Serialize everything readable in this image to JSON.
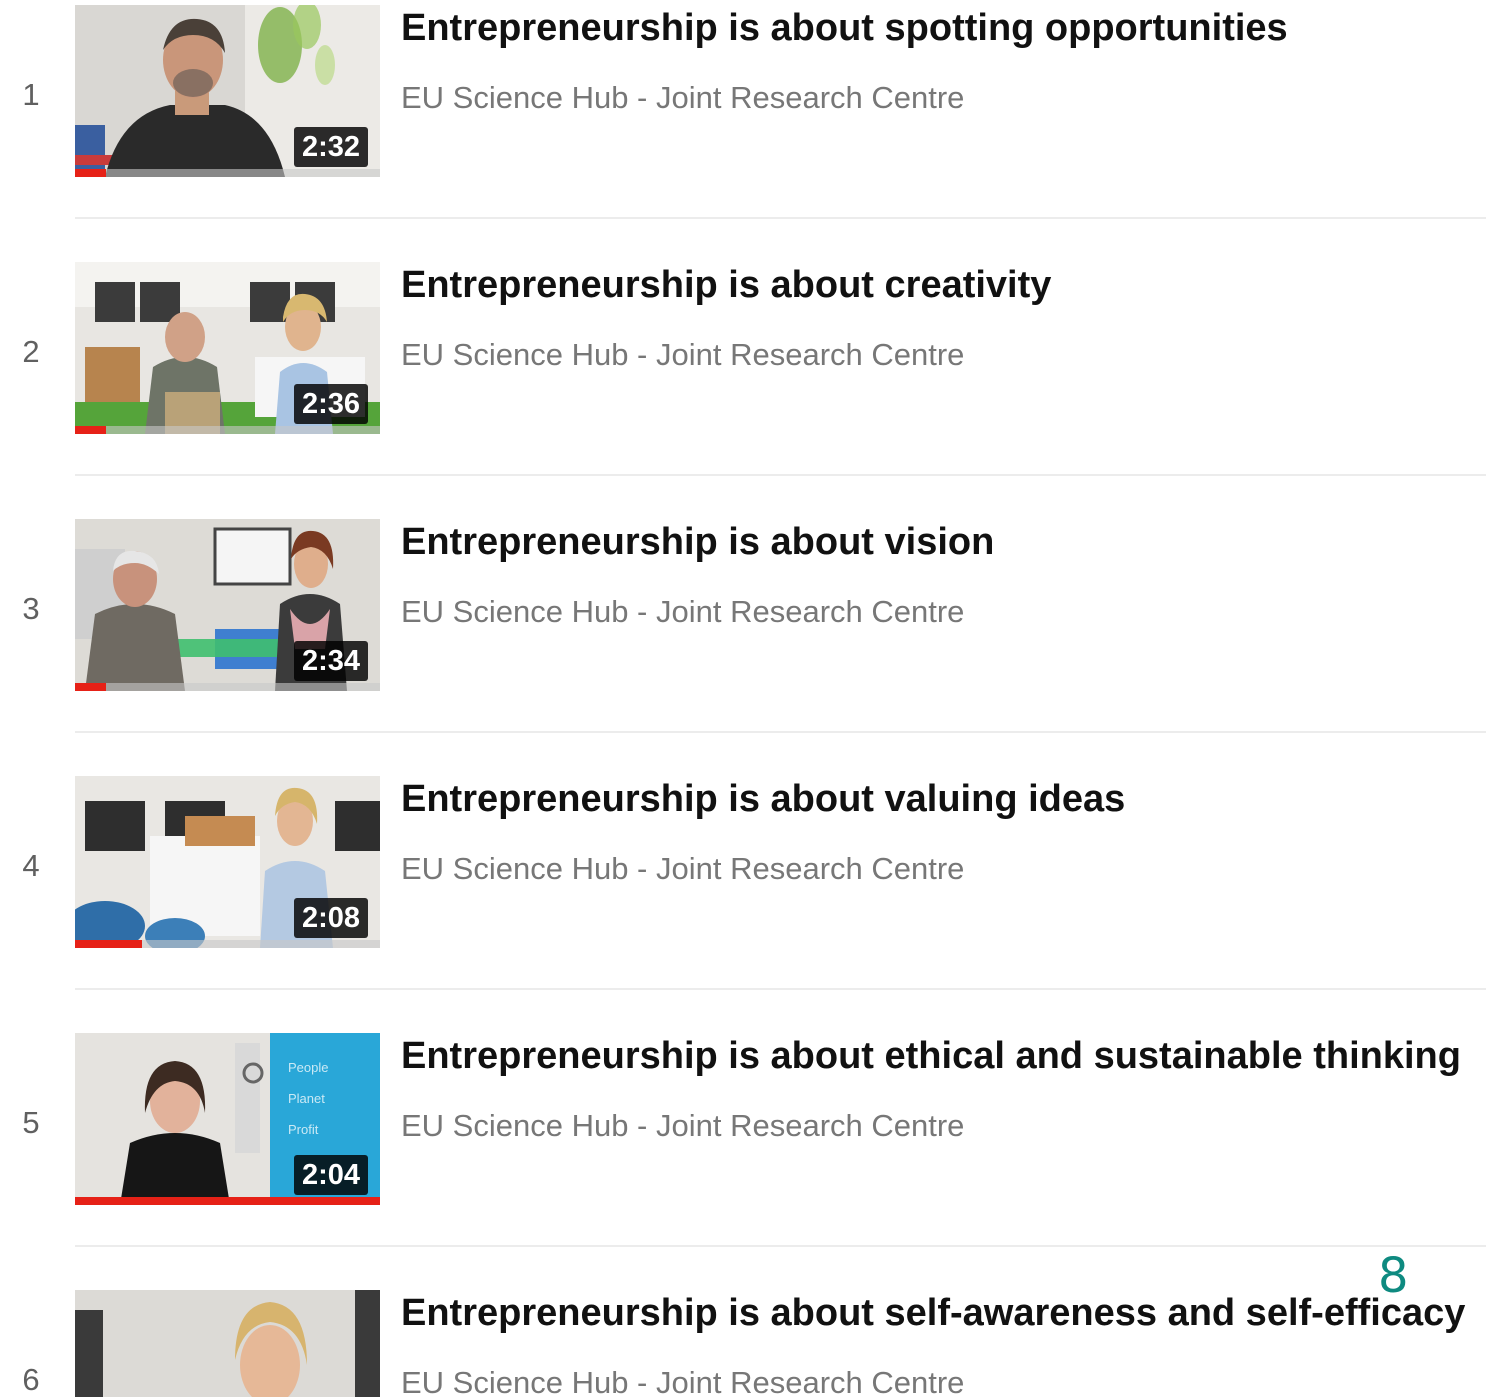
{
  "playlist": {
    "items": [
      {
        "index": "1",
        "title": "Entrepreneurship is about spotting opportunities",
        "channel": "EU Science Hub - Joint Research Centre",
        "duration": "2:32",
        "watched_fraction": 0.1
      },
      {
        "index": "2",
        "title": "Entrepreneurship is about creativity",
        "channel": "EU Science Hub - Joint Research Centre",
        "duration": "2:36",
        "watched_fraction": 0.1
      },
      {
        "index": "3",
        "title": "Entrepreneurship is about vision",
        "channel": "EU Science Hub - Joint Research Centre",
        "duration": "2:34",
        "watched_fraction": 0.1
      },
      {
        "index": "4",
        "title": "Entrepreneurship is about valuing ideas",
        "channel": "EU Science Hub - Joint Research Centre",
        "duration": "2:08",
        "watched_fraction": 0.22
      },
      {
        "index": "5",
        "title": "Entrepreneurship is about ethical and sustainable thinking",
        "channel": "EU Science Hub - Joint Research Centre",
        "duration": "2:04",
        "watched_fraction": 1.0,
        "thumbnail_overlay": [
          "People",
          "Planet",
          "Profit"
        ]
      },
      {
        "index": "6",
        "title": "Entrepreneurship is about self-awareness and self-efficacy",
        "channel": "EU Science Hub - Joint Research Centre",
        "duration": "",
        "watched_fraction": 0
      }
    ]
  },
  "page_number": "8",
  "colors": {
    "progress": "#e62117",
    "page_number": "#0e8a80",
    "channel_text": "#777777",
    "title_text": "#111111"
  }
}
